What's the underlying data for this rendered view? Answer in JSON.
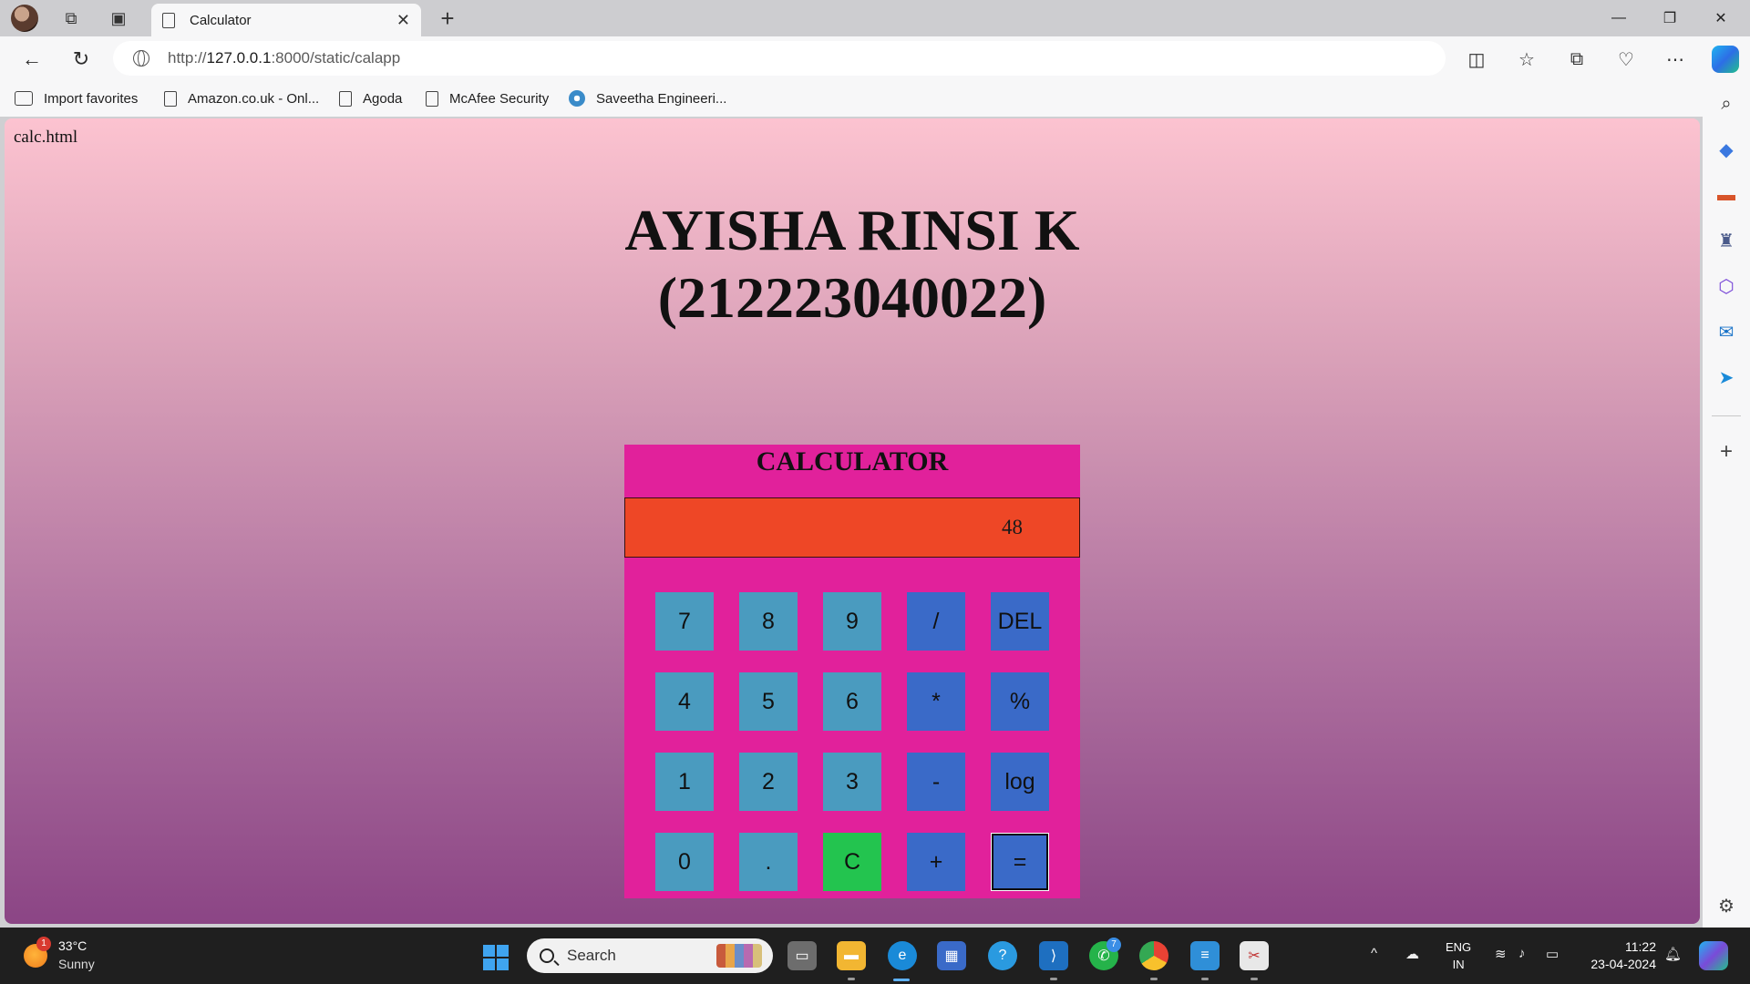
{
  "browser": {
    "tab_title": "Calculator",
    "url_prefix": "http://",
    "url_host": "127.0.0.1",
    "url_path": ":8000/static/calapp"
  },
  "favorites": [
    {
      "label": "Import favorites"
    },
    {
      "label": "Amazon.co.uk - Onl..."
    },
    {
      "label": "Agoda"
    },
    {
      "label": "McAfee Security"
    },
    {
      "label": "Saveetha Engineeri..."
    }
  ],
  "page": {
    "filename": "calc.html",
    "heading_line1": "AYISHA RINSI K",
    "heading_line2": "(212223040022)",
    "calc_title": "CALCULATOR",
    "display_value": "48",
    "keys": [
      {
        "label": "7",
        "kind": "num"
      },
      {
        "label": "8",
        "kind": "num"
      },
      {
        "label": "9",
        "kind": "num"
      },
      {
        "label": "/",
        "kind": "op"
      },
      {
        "label": "DEL",
        "kind": "op"
      },
      {
        "label": "4",
        "kind": "num"
      },
      {
        "label": "5",
        "kind": "num"
      },
      {
        "label": "6",
        "kind": "num"
      },
      {
        "label": "*",
        "kind": "op"
      },
      {
        "label": "%",
        "kind": "op"
      },
      {
        "label": "1",
        "kind": "num"
      },
      {
        "label": "2",
        "kind": "num"
      },
      {
        "label": "3",
        "kind": "num"
      },
      {
        "label": "-",
        "kind": "op"
      },
      {
        "label": "log",
        "kind": "op"
      },
      {
        "label": "0",
        "kind": "num"
      },
      {
        "label": ".",
        "kind": "num"
      },
      {
        "label": "C",
        "kind": "clr"
      },
      {
        "label": "+",
        "kind": "op"
      },
      {
        "label": "=",
        "kind": "eq"
      }
    ],
    "colors": {
      "calc_body": "#e1219b",
      "display": "#ee4726",
      "num_key": "#4a9bbf",
      "op_key": "#3a6ac8",
      "clear_key": "#23c44f"
    }
  },
  "taskbar": {
    "weather_temp": "33°C",
    "weather_condition": "Sunny",
    "weather_badge": "1",
    "search_placeholder": "Search",
    "whatsapp_badge": "7",
    "lang_line1": "ENG",
    "lang_line2": "IN",
    "time": "11:22",
    "date": "23-04-2024"
  }
}
